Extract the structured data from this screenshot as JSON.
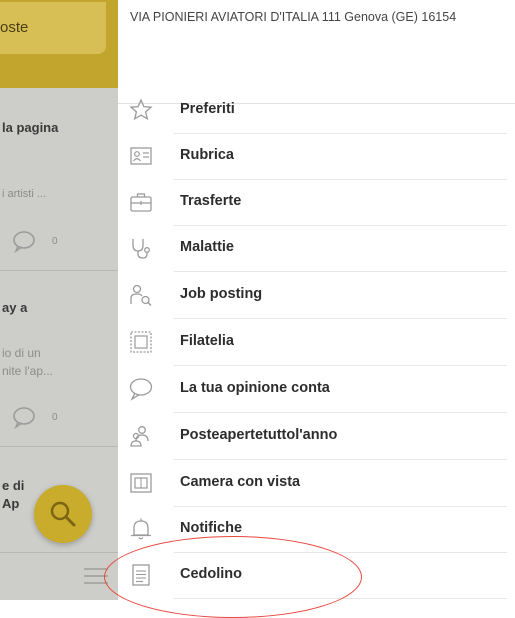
{
  "background_app": {
    "header_button": "oste",
    "texts": [
      "la pagina",
      "i artisti ...",
      "ay a",
      "io di un",
      "nite l'ap...",
      "e di",
      "Ap"
    ],
    "counts": [
      "0",
      "0"
    ]
  },
  "drawer": {
    "address": "VIA PIONIERI AVIATORI D'ITALIA 111 Genova (GE) 16154",
    "menu": [
      {
        "label": "Preferiti",
        "icon": "star-icon"
      },
      {
        "label": "Rubrica",
        "icon": "contact-card-icon"
      },
      {
        "label": "Trasferte",
        "icon": "briefcase-icon"
      },
      {
        "label": "Malattie",
        "icon": "stethoscope-icon"
      },
      {
        "label": "Job posting",
        "icon": "job-search-icon"
      },
      {
        "label": "Filatelia",
        "icon": "stamp-icon"
      },
      {
        "label": "La tua opinione conta",
        "icon": "speech-bubble-icon"
      },
      {
        "label": "Posteapertetuttol'anno",
        "icon": "people-icon"
      },
      {
        "label": "Camera con vista",
        "icon": "picture-frame-icon"
      },
      {
        "label": "Notifiche",
        "icon": "bell-icon"
      },
      {
        "label": "Cedolino",
        "icon": "document-icon"
      }
    ]
  },
  "colors": {
    "accent_yellow": "#c9ac2b",
    "highlight_red": "#e8473e",
    "icon_gray": "#9a9a9a"
  }
}
